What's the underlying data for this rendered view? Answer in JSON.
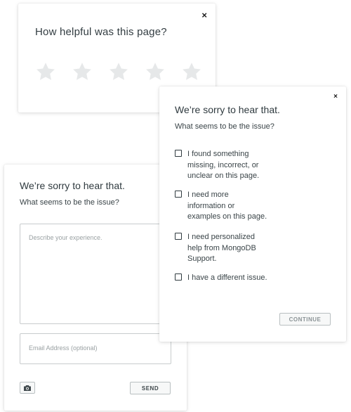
{
  "rating_card": {
    "close_glyph": "×",
    "title": "How helpful was this page?",
    "stars": {
      "count": 5,
      "selected": 0,
      "color": "#e6e8e9"
    }
  },
  "issue_card": {
    "close_glyph": "×",
    "title": "We’re sorry to hear that.",
    "subtitle": "What seems to be the issue?",
    "options": [
      {
        "label": "I found something\nmissing, incorrect, or\nunclear on this page.",
        "checked": false
      },
      {
        "label": "I need more\ninformation or\nexamples on this page.",
        "checked": false
      },
      {
        "label": "I need personalized\nhelp from MongoDB\nSupport.",
        "checked": false
      },
      {
        "label": "I have a different issue.",
        "checked": false
      }
    ],
    "continue_label": "CONTINUE"
  },
  "text_card": {
    "title": "We’re sorry to hear that.",
    "subtitle": "What seems to be the issue?",
    "describe_placeholder": "Describe your experience.",
    "email_placeholder": "Email Address (optional)",
    "camera_icon": "camera-icon",
    "send_label": "SEND"
  },
  "colors": {
    "star": "#e6e8e9",
    "text": "#2f3a3f",
    "placeholder": "#9aa1a3",
    "border": "#c8cccd"
  }
}
